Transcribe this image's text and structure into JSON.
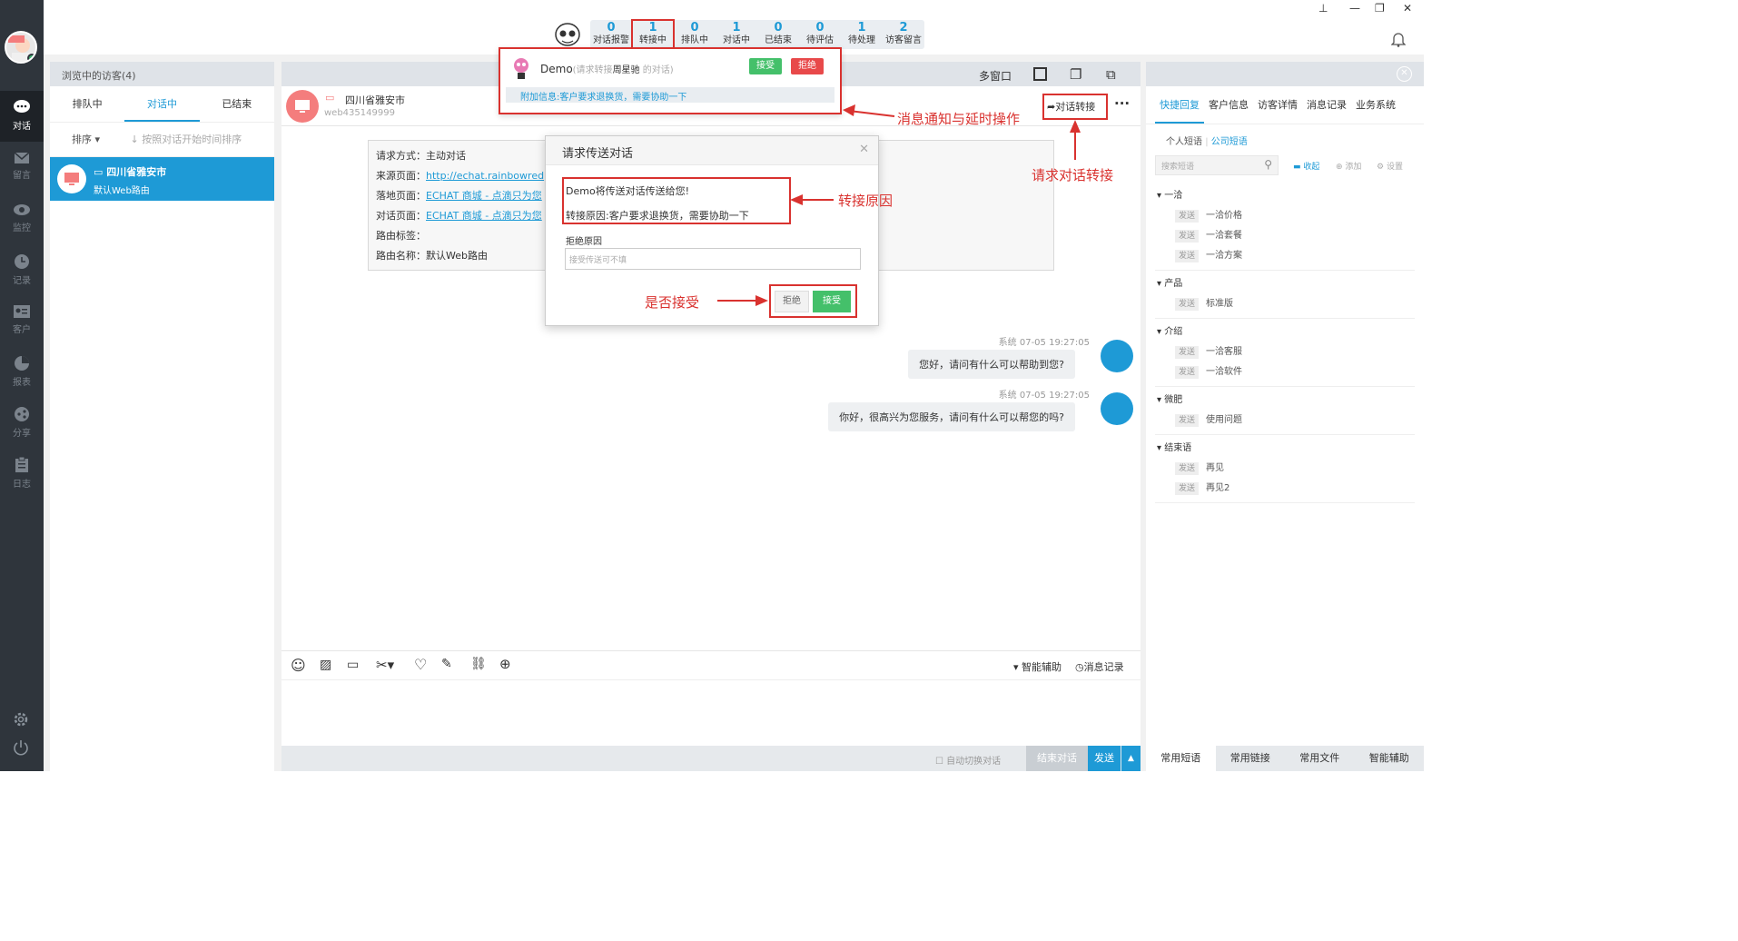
{
  "topstats": [
    {
      "num": "0",
      "label": "对话报警"
    },
    {
      "num": "1",
      "label": "转接中"
    },
    {
      "num": "0",
      "label": "排队中"
    },
    {
      "num": "1",
      "label": "对话中"
    },
    {
      "num": "0",
      "label": "已结束"
    },
    {
      "num": "0",
      "label": "待评估"
    },
    {
      "num": "1",
      "label": "待处理"
    },
    {
      "num": "2",
      "label": "访客留言"
    }
  ],
  "nav": {
    "items": [
      "对话",
      "留言",
      "监控",
      "记录",
      "客户",
      "报表",
      "分享",
      "日志"
    ]
  },
  "visitors": {
    "header": "浏览中的访客(4)",
    "tabs": [
      "排队中",
      "对话中",
      "已结束"
    ],
    "sort": "排序",
    "sort_hint": "↓ 按照对话开始时间排序",
    "row": {
      "name": "四川省雅安市",
      "sub": "默认Web路由"
    }
  },
  "chat": {
    "header_actions": "多窗口",
    "location": "四川省雅安市",
    "visitor_id": "web435149999",
    "transfer_label": "对话转接",
    "info": {
      "request_label": "请求方式：",
      "request_value": "主动对话",
      "source_label": "来源页面：",
      "source_value": "http://echat.rainbowred",
      "landing_label": "落地页面：",
      "landing_value": "ECHAT 商城 - 点滴只为您",
      "chat_label": "对话页面：",
      "chat_value": "ECHAT 商城 - 点滴只为您",
      "tag_label": "路由标签：",
      "route_label": "路由名称：",
      "route_value": "默认Web路由"
    },
    "messages": [
      {
        "meta": "系统 07-05 19:27:05",
        "text": "您好，请问有什么可以帮助到您?"
      },
      {
        "meta": "系统 07-05 19:27:05",
        "text": "你好，很高兴为您服务，请问有什么可以帮您的吗?"
      }
    ],
    "toolbar_right": [
      "智能辅助",
      "消息记录"
    ],
    "auto_switch": "自动切换对话",
    "end_button": "结束对话",
    "send_button": "发送"
  },
  "notification": {
    "name": "Demo",
    "desc_prefix": "(请求转接",
    "desc_name": "周星驰",
    "desc_suffix": " 的对话)",
    "accept": "接受",
    "reject": "拒绝",
    "extra": "附加信息:客户要求退换货，需要协助一下"
  },
  "dialog": {
    "title": "请求传送对话",
    "line1": "Demo将传送对话传送给您!",
    "line2": "转接原因:客户要求退换货，需要协助一下",
    "reason_label": "拒绝原因",
    "reason_placeholder": "接受传送可不填",
    "reject": "拒绝",
    "accept": "接受"
  },
  "annotations": {
    "notif": "消息通知与延时操作",
    "transfer": "请求对话转接",
    "reason": "转接原因",
    "accept": "是否接受"
  },
  "right": {
    "tabs": [
      "快捷回复",
      "客户信息",
      "访客详情",
      "消息记录",
      "业务系统"
    ],
    "subtabs": [
      "个人短语",
      "公司短语"
    ],
    "search_placeholder": "搜索短语",
    "actions": [
      "收起",
      "添加",
      "设置"
    ],
    "send_tag": "发送",
    "groups": [
      {
        "name": "一洽",
        "items": [
          "一洽价格",
          "一洽套餐",
          "一洽方案"
        ]
      },
      {
        "name": "产品",
        "items": [
          "标准版"
        ]
      },
      {
        "name": "介绍",
        "items": [
          "一洽客服",
          "一洽软件"
        ]
      },
      {
        "name": "微肥",
        "items": [
          "使用问题"
        ]
      },
      {
        "name": "结束语",
        "items": [
          "再见",
          "再见2"
        ]
      }
    ],
    "footer": [
      "常用短语",
      "常用链接",
      "常用文件",
      "智能辅助"
    ]
  },
  "colors": {
    "accent": "#1e9ad6",
    "annotation": "#d9322f",
    "nav": "#2f353c"
  }
}
